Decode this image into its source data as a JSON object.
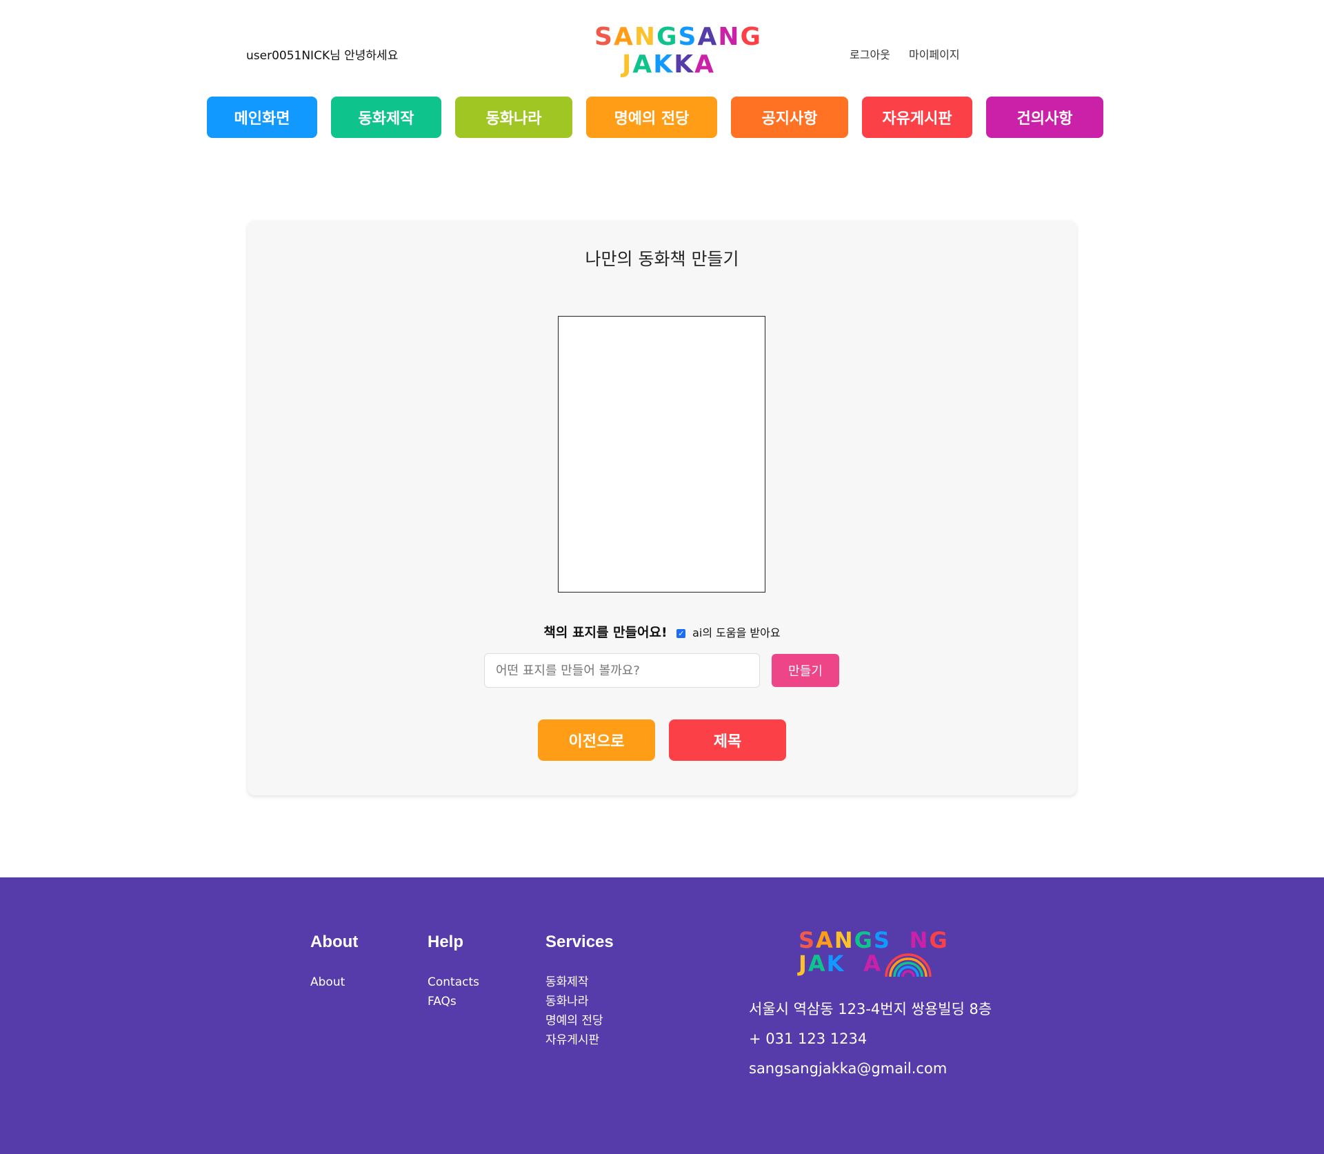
{
  "header": {
    "greeting": "user0051NICK님 안녕하세요",
    "logo_line1": "SANGSANG",
    "logo_line2": "JAKKA",
    "logout": "로그아웃",
    "mypage": "마이페이지"
  },
  "nav": [
    {
      "label": "메인화면",
      "color": "#1199ff"
    },
    {
      "label": "동화제작",
      "color": "#0fc38c"
    },
    {
      "label": "동화나라",
      "color": "#9fc622"
    },
    {
      "label": "명예의 전당",
      "color": "#ff9e16"
    },
    {
      "label": "공지사항",
      "color": "#ff7224"
    },
    {
      "label": "자유게시판",
      "color": "#fc4047"
    },
    {
      "label": "건의사항",
      "color": "#cb21a8"
    }
  ],
  "main": {
    "title": "나만의 동화책 만들기",
    "cover_label": "책의 표지를 만들어요!",
    "ai_checkbox_label": "ai의 도움을 받아요",
    "ai_checked": true,
    "input_placeholder": "어떤 표지를 만들어 볼까요?",
    "input_value": "",
    "make_button": "만들기",
    "prev_button": "이전으로",
    "title_button": "제목"
  },
  "footer": {
    "about_heading": "About",
    "about_links": [
      "About"
    ],
    "help_heading": "Help",
    "help_links": [
      "Contacts",
      "FAQs"
    ],
    "services_heading": "Services",
    "services_links": [
      "동화제작",
      "동화나라",
      "명예의 전당",
      "자유게시판"
    ],
    "logo_line1": "SANGSANG",
    "logo_line2": "JAKKA",
    "address": "서울시 역삼동 123-4번지 쌍용빌딩 8층",
    "phone": "+ 031 123 1234",
    "email": "sangsangjakka@gmail.com",
    "background_color": "#553caa"
  },
  "logo_colors": [
    "#f15a4a",
    "#ff9e16",
    "#fcc22c",
    "#0fc38c",
    "#1199ff",
    "#553caa",
    "#cb21a8",
    "#fc4047"
  ]
}
